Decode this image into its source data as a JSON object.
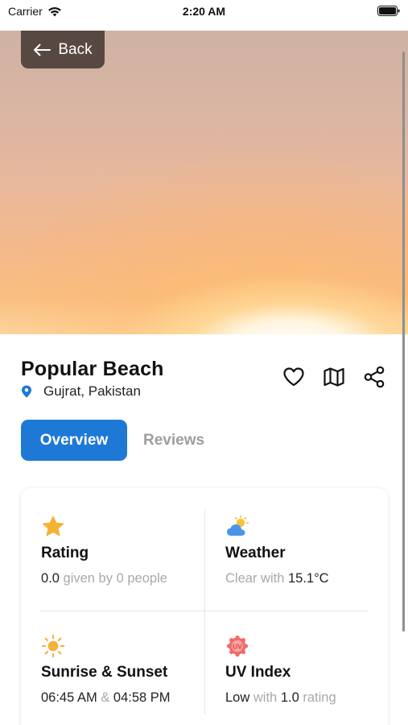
{
  "status_bar": {
    "carrier": "Carrier",
    "time": "2:20 AM"
  },
  "header": {
    "back_label": "Back"
  },
  "place": {
    "name": "Popular Beach",
    "location": "Gujrat, Pakistan"
  },
  "tabs": [
    {
      "label": "Overview",
      "active": true
    },
    {
      "label": "Reviews",
      "active": false
    }
  ],
  "overview": {
    "rating": {
      "icon": "star-icon",
      "label": "Rating",
      "value": "0.0",
      "connector": "given by",
      "count": "0",
      "suffix": "people"
    },
    "weather": {
      "icon": "partly-cloudy-icon",
      "label": "Weather",
      "condition": "Clear",
      "connector": "with",
      "temperature": "15.1°C"
    },
    "sun": {
      "icon": "sun-icon",
      "label": "Sunrise & Sunset",
      "sunrise": "06:45 AM",
      "connector": "&",
      "sunset": "04:58 PM"
    },
    "uv": {
      "icon": "uv-badge-icon",
      "label": "UV Index",
      "level": "Low",
      "connector": "with",
      "value": "1.0",
      "suffix": "rating"
    }
  },
  "colors": {
    "primary": "#1e78d6",
    "star": "#f5b335",
    "sun": "#f6b13b",
    "uv": "#ef6b6b",
    "muted": "#a9a9a9"
  },
  "icons": [
    "wifi-icon",
    "battery-icon",
    "back-arrow-icon",
    "location-pin-icon",
    "heart-icon",
    "map-icon",
    "share-icon"
  ]
}
